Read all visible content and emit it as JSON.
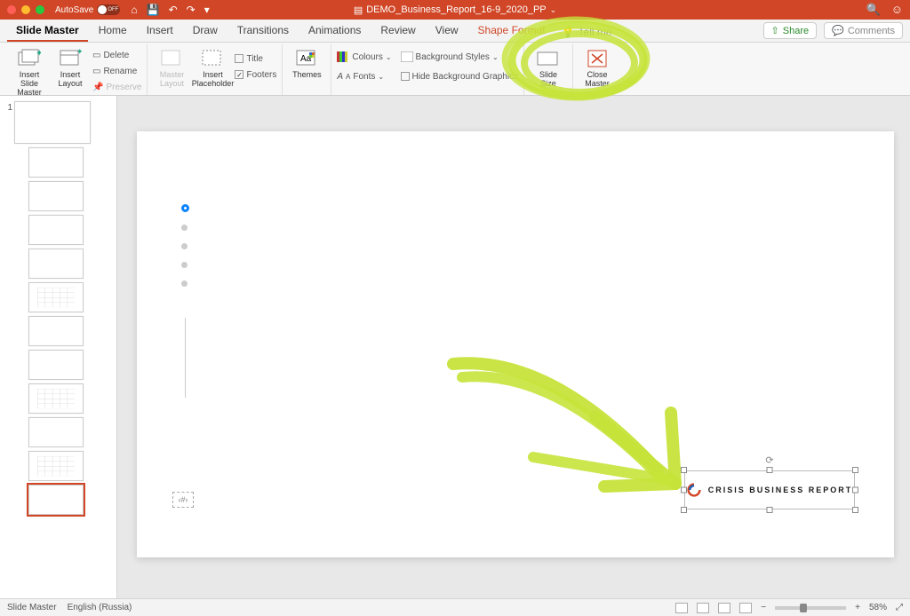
{
  "titlebar": {
    "autosave_label": "AutoSave",
    "autosave_state": "OFF",
    "doc_title": "DEMO_Business_Report_16-9_2020_PP"
  },
  "tabs": {
    "items": [
      "Slide Master",
      "Home",
      "Insert",
      "Draw",
      "Transitions",
      "Animations",
      "Review",
      "View",
      "Shape Format"
    ],
    "tellme": "Tell me",
    "share": "Share",
    "comments": "Comments"
  },
  "ribbon": {
    "insert_slide_master": "Insert Slide\nMaster",
    "insert_layout": "Insert\nLayout",
    "delete": "Delete",
    "rename": "Rename",
    "preserve": "Preserve",
    "master_layout": "Master\nLayout",
    "insert_placeholder": "Insert\nPlaceholder",
    "title_chk": "Title",
    "footers_chk": "Footers",
    "themes": "Themes",
    "colours": "Colours",
    "fonts": "Fonts",
    "bg_styles": "Background Styles",
    "hide_bg": "Hide Background Graphics",
    "slide_size": "Slide\nSize",
    "close_master": "Close\nMaster"
  },
  "slide": {
    "logo_text": "CRISIS BUSINESS REPORT",
    "pagenum_placeholder": "‹#›"
  },
  "thumbs": {
    "master_num": "1"
  },
  "status": {
    "mode": "Slide Master",
    "lang": "English (Russia)",
    "zoom": "58%"
  }
}
